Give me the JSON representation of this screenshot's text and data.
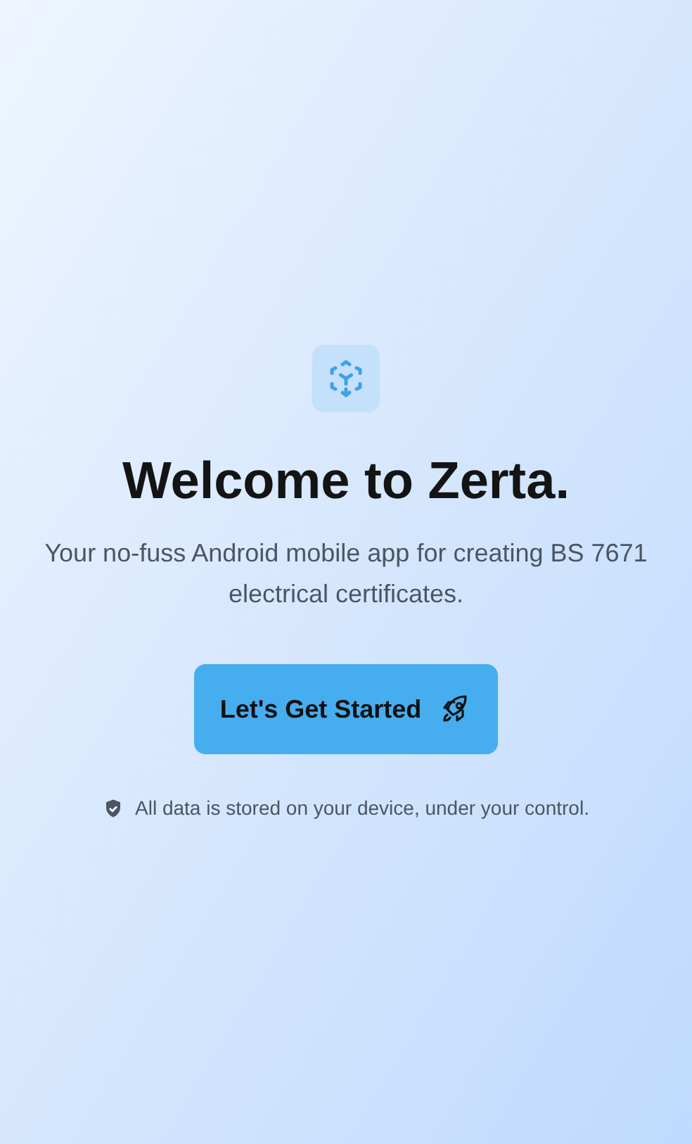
{
  "title": "Welcome to Zerta.",
  "subtitle": "Your no-fuss Android mobile app for creating BS 7671 electrical certificates.",
  "button": {
    "label": "Let's Get Started"
  },
  "note": "All data is stored on your device, under your control."
}
